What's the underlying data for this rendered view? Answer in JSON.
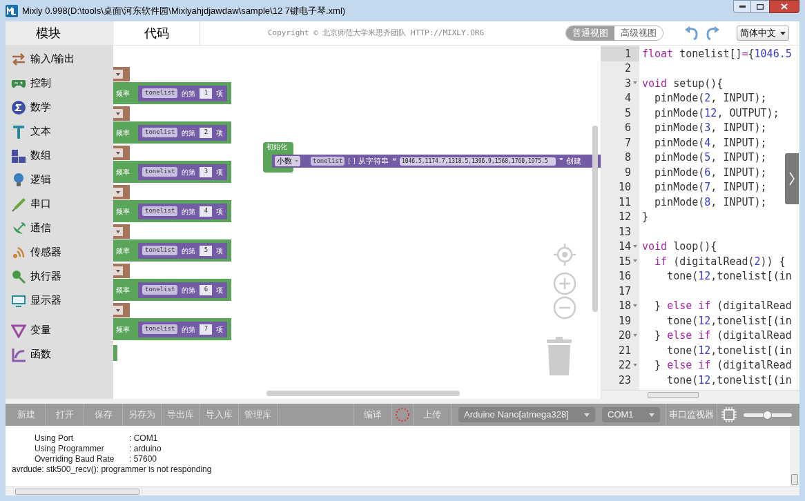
{
  "window": {
    "title": "Mixly 0.998(D:\\tools\\桌面\\河东软件园\\Mixlyahjdjawdaw\\sample\\12 7键电子琴.xml)"
  },
  "tabs": [
    {
      "label": "模块",
      "selected": true
    },
    {
      "label": "代码",
      "selected": false
    }
  ],
  "copyright": "Copyright © 北京师范大学米思齐团队 HTTP://MIXLY.ORG",
  "view_modes": [
    {
      "label": "普通视图",
      "selected": true
    },
    {
      "label": "高级视图",
      "selected": false
    }
  ],
  "language": "简体中文",
  "categories": [
    [
      {
        "label": "输入/输出",
        "kind": "arrows",
        "color": "#a86a45"
      },
      {
        "label": "控制",
        "kind": "gamepad",
        "color": "#3a8a4a"
      },
      {
        "label": "数学",
        "kind": "circle",
        "color": "#3f4fa8"
      },
      {
        "label": "文本",
        "kind": "text",
        "color": "#2a8a9a"
      },
      {
        "label": "数组",
        "kind": "blocks",
        "color": "#4a4ea0"
      },
      {
        "label": "逻辑",
        "kind": "bulb",
        "color": "#3a7fc0"
      },
      {
        "label": "串口",
        "kind": "pen",
        "color": "#6aa83a"
      },
      {
        "label": "通信",
        "kind": "dish",
        "color": "#3a9a5a"
      },
      {
        "label": "传感器",
        "kind": "signal",
        "color": "#c8843a"
      },
      {
        "label": "执行器",
        "kind": "pin",
        "color": "#4a9a4a"
      },
      {
        "label": "显示器",
        "kind": "monitor",
        "color": "#2a8aa0"
      }
    ],
    [
      {
        "label": "变量",
        "kind": "triangle",
        "color": "#9a4aa0"
      },
      {
        "label": "函数",
        "kind": "axes",
        "color": "#8a5ab0"
      }
    ]
  ],
  "workspace": {
    "list_blocks": [
      {
        "label": "频率",
        "list": "tonelist",
        "of": "的第",
        "index": "1",
        "item": "项"
      },
      {
        "label": "频率",
        "list": "tonelist",
        "of": "的第",
        "index": "2",
        "item": "项"
      },
      {
        "label": "频率",
        "list": "tonelist",
        "of": "的第",
        "index": "3",
        "item": "项"
      },
      {
        "label": "频率",
        "list": "tonelist",
        "of": "的第",
        "index": "4",
        "item": "项"
      },
      {
        "label": "频率",
        "list": "tonelist",
        "of": "的第",
        "index": "5",
        "item": "项"
      },
      {
        "label": "频率",
        "list": "tonelist",
        "of": "的第",
        "index": "6",
        "item": "项"
      },
      {
        "label": "频率",
        "list": "tonelist",
        "of": "的第",
        "index": "7",
        "item": "项"
      }
    ],
    "init_block": {
      "label": "初始化",
      "type": "小数",
      "name": "tonelist",
      "open_bracket": "[",
      "close_bracket": "]",
      "from": "从字符串",
      "open_quote": "“",
      "value": "1046.5,1174.7,1318.5,1396.9,1568,1760,1975.5",
      "close_quote": "”",
      "create": "创建"
    }
  },
  "code": {
    "lines": [
      {
        "number": "1",
        "fold": false,
        "active": true,
        "tokens": [
          {
            "kind": "kw",
            "text": "float"
          },
          {
            "kind": "plain",
            "text": " tonelist[]"
          },
          {
            "kind": "kw",
            "text": "="
          },
          {
            "kind": "plain",
            "text": "{"
          },
          {
            "kind": "num",
            "text": "1046.5"
          }
        ]
      },
      {
        "number": "2",
        "fold": false,
        "active": false
      },
      {
        "number": "3",
        "fold": true,
        "active": false,
        "tokens": [
          {
            "kind": "kw",
            "text": "void"
          },
          {
            "kind": "plain",
            "text": " setup(){"
          }
        ]
      },
      {
        "number": "4",
        "fold": false,
        "active": false,
        "tokens": [
          {
            "kind": "plain",
            "text": "  pinMode("
          },
          {
            "kind": "num",
            "text": "2"
          },
          {
            "kind": "plain",
            "text": ", INPUT);"
          }
        ]
      },
      {
        "number": "5",
        "fold": false,
        "active": false,
        "tokens": [
          {
            "kind": "plain",
            "text": "  pinMode("
          },
          {
            "kind": "num",
            "text": "12"
          },
          {
            "kind": "plain",
            "text": ", OUTPUT);"
          }
        ]
      },
      {
        "number": "6",
        "fold": false,
        "active": false,
        "tokens": [
          {
            "kind": "plain",
            "text": "  pinMode("
          },
          {
            "kind": "num",
            "text": "3"
          },
          {
            "kind": "plain",
            "text": ", INPUT);"
          }
        ]
      },
      {
        "number": "7",
        "fold": false,
        "active": false,
        "tokens": [
          {
            "kind": "plain",
            "text": "  pinMode("
          },
          {
            "kind": "num",
            "text": "4"
          },
          {
            "kind": "plain",
            "text": ", INPUT);"
          }
        ]
      },
      {
        "number": "8",
        "fold": false,
        "active": false,
        "tokens": [
          {
            "kind": "plain",
            "text": "  pinMode("
          },
          {
            "kind": "num",
            "text": "5"
          },
          {
            "kind": "plain",
            "text": ", INPUT);"
          }
        ]
      },
      {
        "number": "9",
        "fold": false,
        "active": false,
        "tokens": [
          {
            "kind": "plain",
            "text": "  pinMode("
          },
          {
            "kind": "num",
            "text": "6"
          },
          {
            "kind": "plain",
            "text": ", INPUT);"
          }
        ]
      },
      {
        "number": "10",
        "fold": false,
        "active": false,
        "tokens": [
          {
            "kind": "plain",
            "text": "  pinMode("
          },
          {
            "kind": "num",
            "text": "7"
          },
          {
            "kind": "plain",
            "text": ", INPUT);"
          }
        ]
      },
      {
        "number": "11",
        "fold": false,
        "active": false,
        "tokens": [
          {
            "kind": "plain",
            "text": "  pinMode("
          },
          {
            "kind": "num",
            "text": "8"
          },
          {
            "kind": "plain",
            "text": ", INPUT);"
          }
        ]
      },
      {
        "number": "12",
        "fold": false,
        "active": false,
        "tokens": [
          {
            "kind": "plain",
            "text": "}"
          }
        ]
      },
      {
        "number": "13",
        "fold": false,
        "active": false
      },
      {
        "number": "14",
        "fold": true,
        "active": false,
        "tokens": [
          {
            "kind": "kw",
            "text": "void"
          },
          {
            "kind": "plain",
            "text": " loop(){"
          }
        ]
      },
      {
        "number": "15",
        "fold": true,
        "active": false,
        "tokens": [
          {
            "kind": "kw",
            "text": "  if"
          },
          {
            "kind": "plain",
            "text": " (digitalRead("
          },
          {
            "kind": "num",
            "text": "2"
          },
          {
            "kind": "plain",
            "text": ")) {"
          }
        ]
      },
      {
        "number": "16",
        "fold": false,
        "active": false,
        "tokens": [
          {
            "kind": "plain",
            "text": "    tone("
          },
          {
            "kind": "num",
            "text": "12"
          },
          {
            "kind": "plain",
            "text": ",tonelist[(in"
          }
        ]
      },
      {
        "number": "17",
        "fold": false,
        "active": false
      },
      {
        "number": "18",
        "fold": true,
        "active": false,
        "tokens": [
          {
            "kind": "plain",
            "text": "  } "
          },
          {
            "kind": "kw",
            "text": "else if"
          },
          {
            "kind": "plain",
            "text": " (digitalRead"
          }
        ]
      },
      {
        "number": "19",
        "fold": false,
        "active": false,
        "tokens": [
          {
            "kind": "plain",
            "text": "    tone("
          },
          {
            "kind": "num",
            "text": "12"
          },
          {
            "kind": "plain",
            "text": ",tonelist[(in"
          }
        ]
      },
      {
        "number": "20",
        "fold": true,
        "active": false,
        "tokens": [
          {
            "kind": "plain",
            "text": "  } "
          },
          {
            "kind": "kw",
            "text": "else if"
          },
          {
            "kind": "plain",
            "text": " (digitalRead"
          }
        ]
      },
      {
        "number": "21",
        "fold": false,
        "active": false,
        "tokens": [
          {
            "kind": "plain",
            "text": "    tone("
          },
          {
            "kind": "num",
            "text": "12"
          },
          {
            "kind": "plain",
            "text": ",tonelist[(in"
          }
        ]
      },
      {
        "number": "22",
        "fold": true,
        "active": false,
        "tokens": [
          {
            "kind": "plain",
            "text": "  } "
          },
          {
            "kind": "kw",
            "text": "else if"
          },
          {
            "kind": "plain",
            "text": " (digitalRead"
          }
        ]
      },
      {
        "number": "23",
        "fold": false,
        "active": false,
        "tokens": [
          {
            "kind": "plain",
            "text": "    tone("
          },
          {
            "kind": "num",
            "text": "12"
          },
          {
            "kind": "plain",
            "text": ",tonelist[(in"
          }
        ]
      }
    ]
  },
  "toolbar": {
    "buttons": [
      "新建",
      "打开",
      "保存",
      "另存为",
      "导出库",
      "导入库",
      "管理库"
    ],
    "compile": "编译",
    "upload": "上传",
    "board": "Arduino Nano[atmega328]",
    "port": "COM1",
    "serial_monitor": "串口监视器",
    "slider": {
      "level": 0.5
    }
  },
  "console": {
    "lines": [
      {
        "kind": "field",
        "label": "Using Port",
        "value": ": COM1"
      },
      {
        "kind": "field",
        "label": "Using Programmer",
        "value": ": arduino"
      },
      {
        "kind": "field",
        "label": "Overriding Baud Rate",
        "value": ": 57600"
      },
      {
        "kind": "text",
        "text": "avrdude: stk500_recv(): programmer is not responding"
      }
    ]
  }
}
